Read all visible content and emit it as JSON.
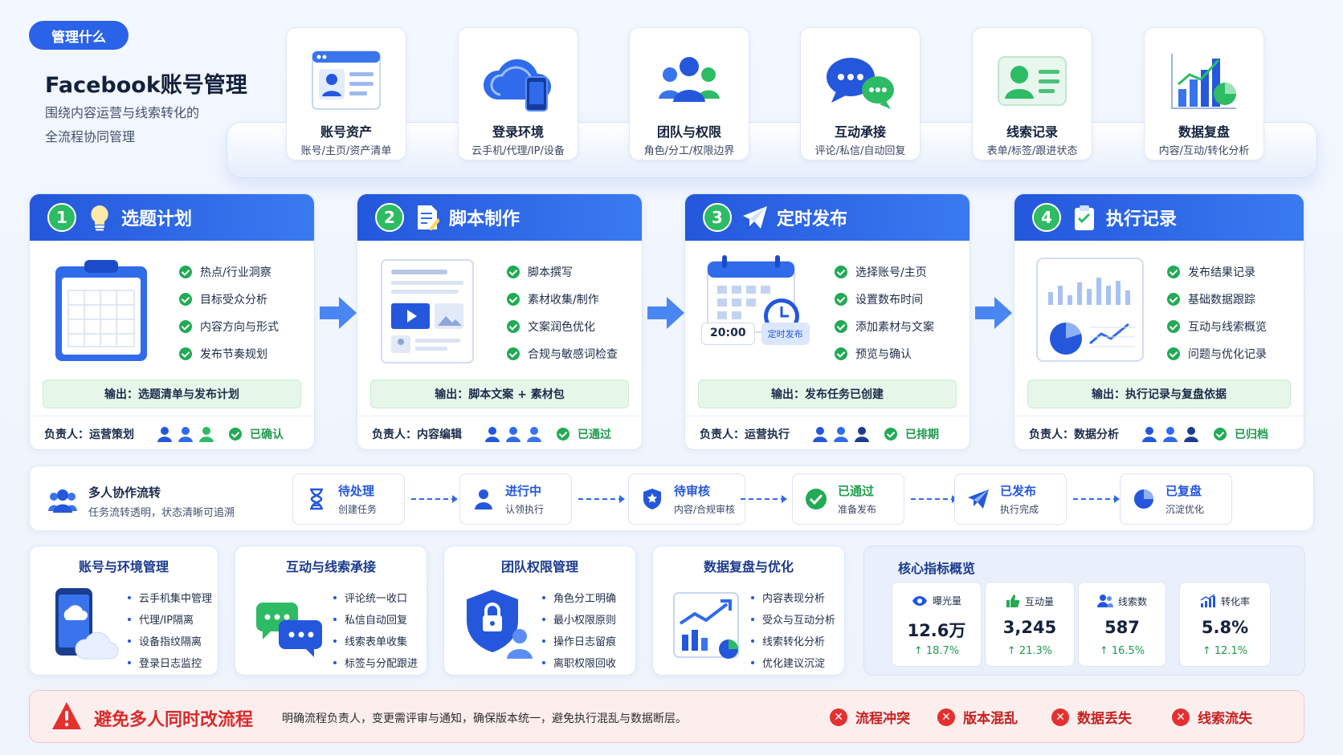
{
  "header": {
    "pill": "管理什么",
    "title": "Facebook账号管理",
    "subtitle_line1": "围绕内容运营与线索转化的",
    "subtitle_line2": "全流程协同管理"
  },
  "modules": [
    {
      "title": "账号资产",
      "desc": "账号/主页/资产清单",
      "icon": "account-card-icon"
    },
    {
      "title": "登录环境",
      "desc": "云手机/代理/IP/设备",
      "icon": "cloud-phone-icon"
    },
    {
      "title": "团队与权限",
      "desc": "角色/分工/权限边界",
      "icon": "team-icon"
    },
    {
      "title": "互动承接",
      "desc": "评论/私信/自动回复",
      "icon": "chat-bubbles-icon"
    },
    {
      "title": "线索记录",
      "desc": "表单/标签/跟进状态",
      "icon": "lead-card-icon"
    },
    {
      "title": "数据复盘",
      "desc": "内容/互动/转化分析",
      "icon": "bar-chart-icon"
    }
  ],
  "steps": [
    {
      "num": "1",
      "title": "选题计划",
      "icon": "lightbulb-icon",
      "items": [
        "热点/行业洞察",
        "目标受众分析",
        "内容方向与形式",
        "发布节奏规划"
      ],
      "output": "输出：选题清单与发布计划",
      "owner": "负责人：运营策划",
      "status": "已确认"
    },
    {
      "num": "2",
      "title": "脚本制作",
      "icon": "document-pen-icon",
      "items": [
        "脚本撰写",
        "素材收集/制作",
        "文案润色优化",
        "合规与敏感词检查"
      ],
      "output": "输出：脚本文案 + 素材包",
      "owner": "负责人：内容编辑",
      "status": "已通过"
    },
    {
      "num": "3",
      "title": "定时发布",
      "icon": "paper-plane-icon",
      "items": [
        "选择账号/主页",
        "设置数布时间",
        "添加素材与文案",
        "预览与确认"
      ],
      "output": "输出：发布任务已创建",
      "owner": "负责人：运营执行",
      "status": "已排期",
      "time": "20:00",
      "tag": "定时发布"
    },
    {
      "num": "4",
      "title": "执行记录",
      "icon": "clipboard-check-icon",
      "items": [
        "发布结果记录",
        "基础数据跟踪",
        "互动与线索概览",
        "问题与优化记录"
      ],
      "output": "输出：执行记录与复盘依据",
      "owner": "负责人：数据分析",
      "status": "已归档"
    }
  ],
  "flow": {
    "title": "多人协作流转",
    "desc": "任务流转透明，状态清晰可追溯",
    "nodes": [
      {
        "status": "待处理",
        "action": "创建任务",
        "icon": "hourglass-icon"
      },
      {
        "status": "进行中",
        "action": "认领执行",
        "icon": "user-icon"
      },
      {
        "status": "待审核",
        "action": "内容/合规审核",
        "icon": "shield-star-icon"
      },
      {
        "status": "已通过",
        "action": "准备发布",
        "icon": "check-circle-icon"
      },
      {
        "status": "已发布",
        "action": "执行完成",
        "icon": "paper-plane-icon"
      },
      {
        "status": "已复盘",
        "action": "沉淀优化",
        "icon": "pie-chart-icon"
      }
    ]
  },
  "bottom_cards": [
    {
      "title": "账号与环境管理",
      "items": [
        "云手机集中管理",
        "代理/IP隔离",
        "设备指纹隔离",
        "登录日志监控"
      ]
    },
    {
      "title": "互动与线索承接",
      "items": [
        "评论统一收口",
        "私信自动回复",
        "线索表单收集",
        "标签与分配跟进"
      ]
    },
    {
      "title": "团队权限管理",
      "items": [
        "角色分工明确",
        "最小权限原则",
        "操作日志留痕",
        "离职权限回收"
      ]
    },
    {
      "title": "数据复盘与优化",
      "items": [
        "内容表现分析",
        "受众与互动分析",
        "线索转化分析",
        "优化建议沉淀"
      ]
    }
  ],
  "kpi": {
    "title": "核心指标概览",
    "cards": [
      {
        "label": "曝光量",
        "value": "12.6万",
        "growth": "↑ 18.7%",
        "icon": "eye-icon"
      },
      {
        "label": "互动量",
        "value": "3,245",
        "growth": "↑ 21.3%",
        "icon": "thumbs-up-icon"
      },
      {
        "label": "线索数",
        "value": "587",
        "growth": "↑ 16.5%",
        "icon": "users-icon"
      },
      {
        "label": "转化率",
        "value": "5.8%",
        "growth": "↑ 12.1%",
        "icon": "trend-bars-icon"
      }
    ]
  },
  "warning": {
    "title": "避免多人同时改流程",
    "desc": "明确流程负责人，变更需评审与通知，确保版本统一，避免执行混乱与数据断层。",
    "risks": [
      "流程冲突",
      "版本混乱",
      "数据丢失",
      "线索流失"
    ]
  },
  "colors": {
    "primary": "#2457dc",
    "success": "#22aa55",
    "danger": "#e53030"
  }
}
